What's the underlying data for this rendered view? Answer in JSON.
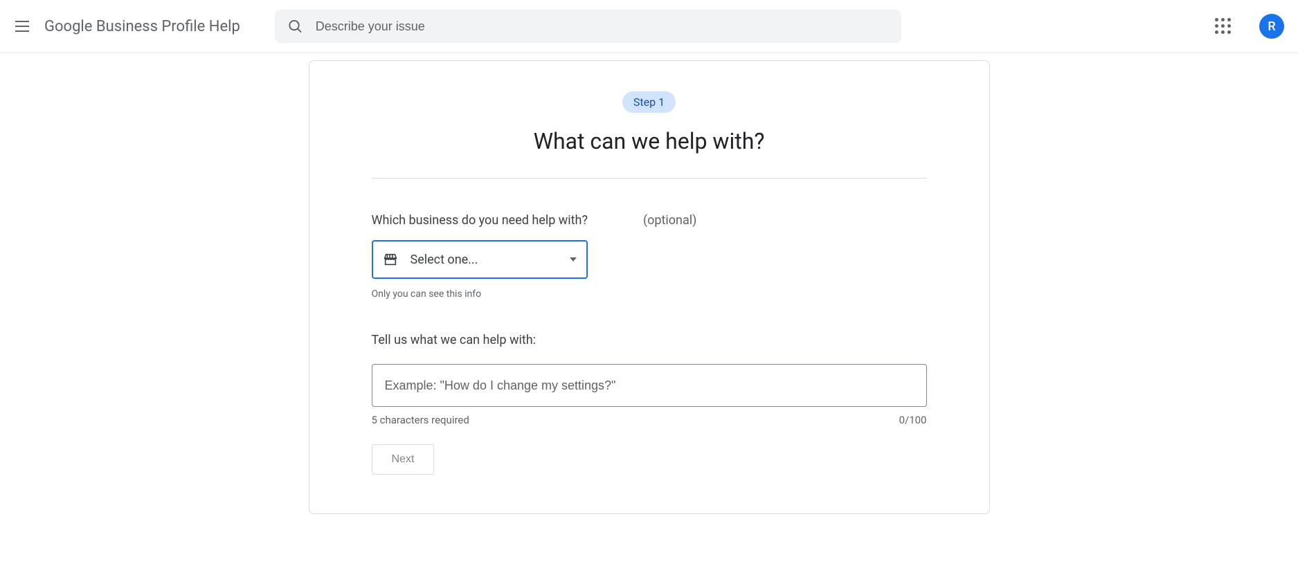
{
  "header": {
    "title": "Google Business Profile Help",
    "search_placeholder": "Describe your issue",
    "avatar_letter": "R"
  },
  "card": {
    "step_badge": "Step 1",
    "title": "What can we help with?",
    "business_label": "Which business do you need help with?",
    "optional_text": "(optional)",
    "select_placeholder": "Select one...",
    "select_helper": "Only you can see this info",
    "issue_label": "Tell us what we can help with:",
    "issue_placeholder": "Example: \"How do I change my settings?\"",
    "chars_required": "5 characters required",
    "char_count": "0/100",
    "next_button": "Next"
  }
}
